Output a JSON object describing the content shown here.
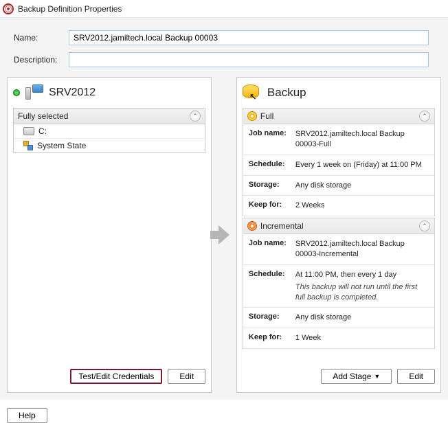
{
  "window": {
    "title": "Backup Definition Properties"
  },
  "form": {
    "name_label": "Name:",
    "name_value": "SRV2012.jamiltech.local Backup 00003",
    "desc_label": "Description:",
    "desc_value": ""
  },
  "left_panel": {
    "title": "SRV2012",
    "tree_header": "Fully selected",
    "items": [
      {
        "label": "C:"
      },
      {
        "label": "System State"
      }
    ],
    "btn_test": "Test/Edit Credentials",
    "btn_edit": "Edit"
  },
  "right_panel": {
    "title": "Backup",
    "sections": [
      {
        "header": "Full",
        "rows": [
          {
            "label": "Job name:",
            "value": "SRV2012.jamiltech.local Backup 00003-Full"
          },
          {
            "label": "Schedule:",
            "value": "Every 1 week on (Friday) at 11:00 PM"
          },
          {
            "label": "Storage:",
            "value": "Any disk storage"
          },
          {
            "label": "Keep for:",
            "value": "2 Weeks"
          }
        ]
      },
      {
        "header": "Incremental",
        "rows": [
          {
            "label": "Job name:",
            "value": "SRV2012.jamiltech.local Backup 00003-Incremental"
          },
          {
            "label": "Schedule:",
            "value": "At 11:00 PM, then every 1 day",
            "note": "This backup will not run until the first full backup is completed."
          },
          {
            "label": "Storage:",
            "value": "Any disk storage"
          },
          {
            "label": "Keep for:",
            "value": "1 Week"
          }
        ]
      }
    ],
    "btn_addstage": "Add Stage",
    "btn_edit": "Edit"
  },
  "bottom": {
    "help": "Help"
  }
}
